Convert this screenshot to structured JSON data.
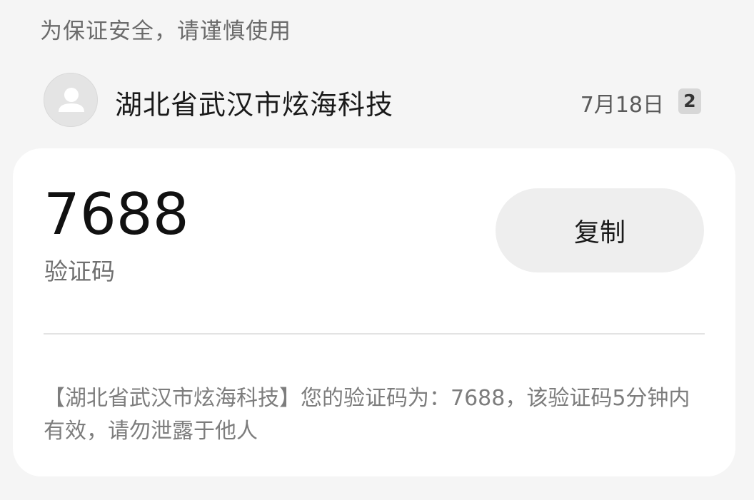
{
  "notice": "为保证安全，请谨慎使用",
  "sender": {
    "avatar_icon": "person-icon",
    "name": "湖北省武汉市炫海科技",
    "date": "7月18日",
    "sim_badge": "2"
  },
  "card": {
    "code": "7688",
    "code_label": "验证码",
    "copy_label": "复制",
    "message": "【湖北省武汉市炫海科技】您的验证码为：7688，该验证码5分钟内有效，请勿泄露于他人"
  }
}
